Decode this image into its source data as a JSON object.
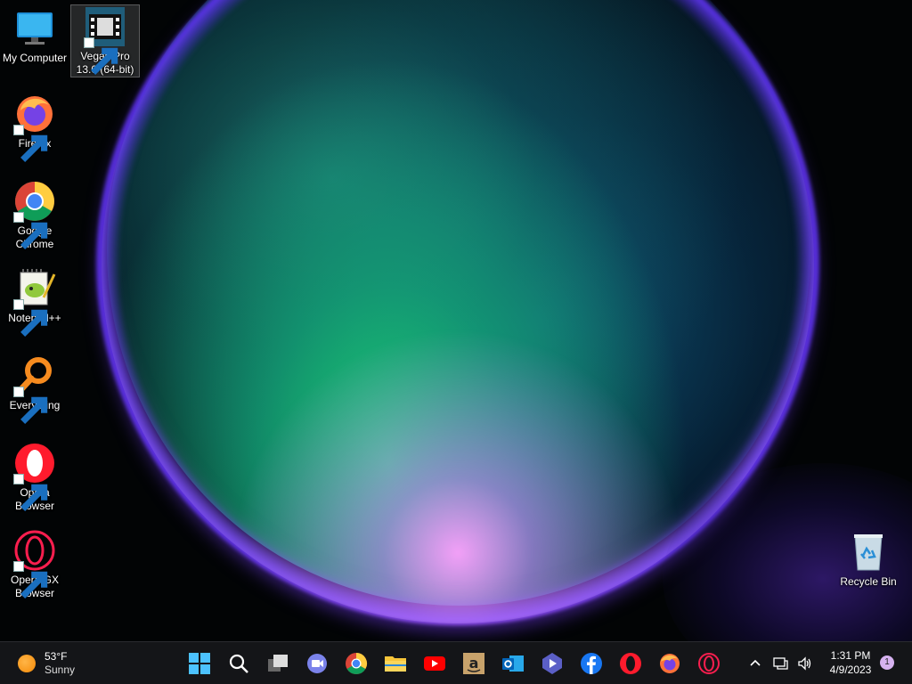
{
  "desktop": {
    "icons": [
      {
        "label": "My Computer",
        "icon": "monitor-icon",
        "shortcut": false
      },
      {
        "label": "Vegas Pro 13.0 (64-bit)",
        "icon": "film-icon",
        "shortcut": true
      },
      {
        "label": "Firefox",
        "icon": "firefox-icon",
        "shortcut": true
      },
      {
        "label": "Google Chrome",
        "icon": "chrome-icon",
        "shortcut": true
      },
      {
        "label": "Notepad++",
        "icon": "notepad-plus-plus-icon",
        "shortcut": true
      },
      {
        "label": "Everything",
        "icon": "magnifier-icon",
        "shortcut": true
      },
      {
        "label": "Opera Browser",
        "icon": "opera-icon",
        "shortcut": true
      },
      {
        "label": "Opera GX Browser",
        "icon": "opera-gx-icon",
        "shortcut": true
      },
      {
        "label": "Recycle Bin",
        "icon": "recycle-bin-icon",
        "shortcut": false
      }
    ]
  },
  "taskbar": {
    "weather": {
      "temp": "53°F",
      "condition": "Sunny",
      "icon": "sun-icon"
    },
    "apps": [
      "start-icon",
      "search-icon",
      "task-view-icon",
      "teams-chat-icon",
      "chrome-icon",
      "file-explorer-icon",
      "youtube-icon",
      "amazon-icon",
      "outlook-icon",
      "clipchamp-icon",
      "facebook-icon",
      "opera-icon",
      "firefox-icon",
      "opera-gx-icon"
    ],
    "tray": [
      "chevron-up-icon",
      "network-icon",
      "volume-icon"
    ],
    "clock": {
      "time": "1:31 PM",
      "date": "4/9/2023"
    },
    "notifications": "1"
  },
  "colors": {
    "taskbar": "#141518",
    "accent": "#0078d4"
  }
}
